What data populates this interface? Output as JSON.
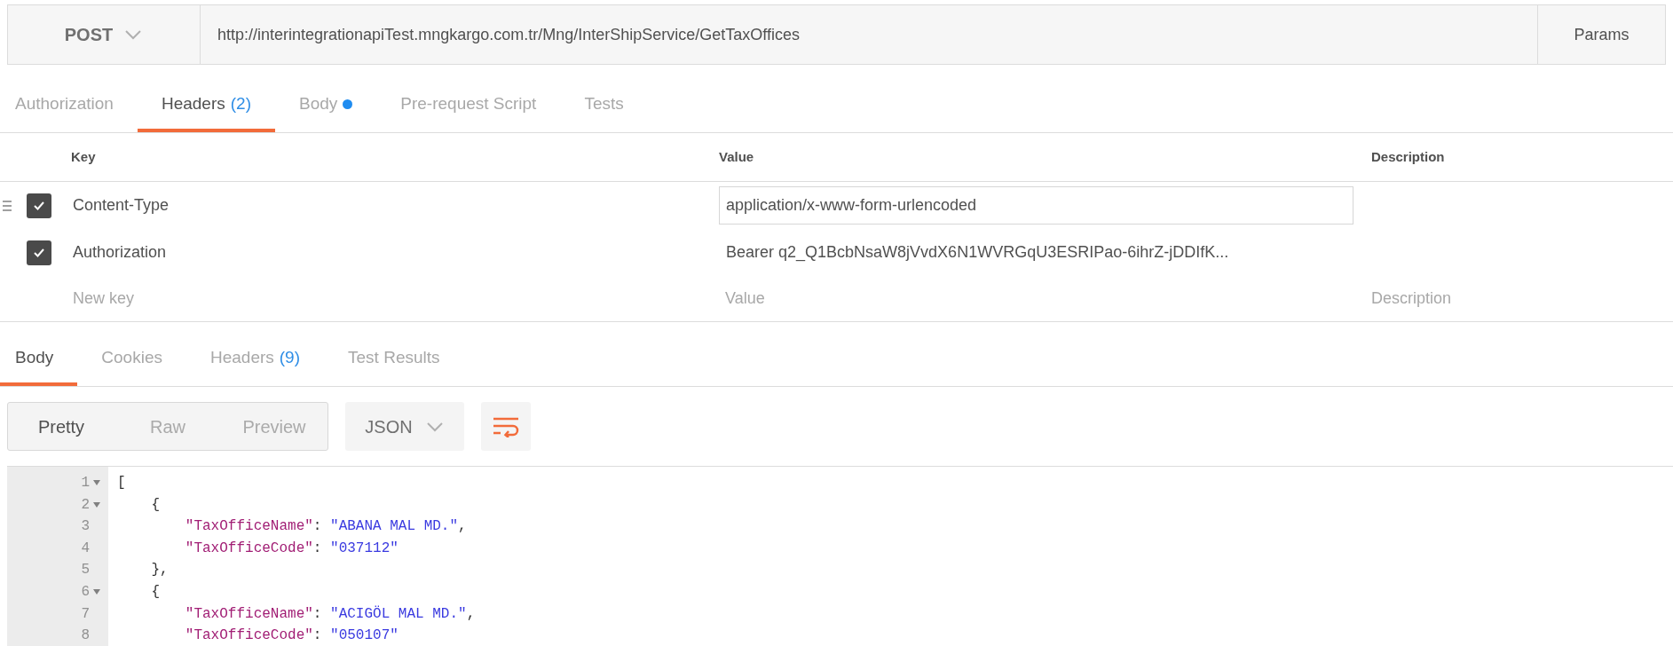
{
  "request_bar": {
    "method": "POST",
    "url": "http://interintegrationapiTest.mngkargo.com.tr/Mng/InterShipService/GetTaxOffices",
    "params_button": "Params"
  },
  "request_tabs": [
    {
      "label": "Authorization",
      "selected": false
    },
    {
      "label": "Headers",
      "count": "(2)",
      "selected": true
    },
    {
      "label": "Body",
      "dot": true,
      "selected": false
    },
    {
      "label": "Pre-request Script",
      "selected": false
    },
    {
      "label": "Tests",
      "selected": false
    }
  ],
  "headers_table": {
    "columns": [
      "Key",
      "Value",
      "Description"
    ],
    "rows": [
      {
        "key": "Content-Type",
        "value": "application/x-www-form-urlencoded",
        "checked": true,
        "editing": true
      },
      {
        "key": "Authorization",
        "value": "Bearer q2_Q1BcbNsaW8jVvdX6N1WVRGqU3ESRIPao-6ihrZ-jDDIfK...",
        "checked": true,
        "editing": false
      }
    ],
    "new_row": {
      "key_placeholder": "New key",
      "value_placeholder": "Value",
      "description_placeholder": "Description"
    }
  },
  "response_tabs": [
    {
      "label": "Body",
      "selected": true
    },
    {
      "label": "Cookies",
      "selected": false
    },
    {
      "label": "Headers",
      "count": "(9)",
      "selected": false
    },
    {
      "label": "Test Results",
      "selected": false
    }
  ],
  "view_modes": [
    {
      "label": "Pretty",
      "selected": true
    },
    {
      "label": "Raw",
      "selected": false
    },
    {
      "label": "Preview",
      "selected": false
    }
  ],
  "format_select": "JSON",
  "code_lines": [
    {
      "number": "1",
      "foldable": true,
      "tokens": [
        {
          "kind": "punct",
          "text": "["
        }
      ]
    },
    {
      "number": "2",
      "foldable": true,
      "tokens": [
        {
          "kind": "punct",
          "text": "    {"
        }
      ]
    },
    {
      "number": "3",
      "foldable": false,
      "tokens": [
        {
          "kind": "key",
          "text": "        \"TaxOfficeName\""
        },
        {
          "kind": "punct",
          "text": ": "
        },
        {
          "kind": "string",
          "text": "\"ABANA MAL MD.\""
        },
        {
          "kind": "punct",
          "text": ","
        }
      ]
    },
    {
      "number": "4",
      "foldable": false,
      "tokens": [
        {
          "kind": "key",
          "text": "        \"TaxOfficeCode\""
        },
        {
          "kind": "punct",
          "text": ": "
        },
        {
          "kind": "string",
          "text": "\"037112\""
        }
      ]
    },
    {
      "number": "5",
      "foldable": false,
      "tokens": [
        {
          "kind": "punct",
          "text": "    },"
        }
      ]
    },
    {
      "number": "6",
      "foldable": true,
      "tokens": [
        {
          "kind": "punct",
          "text": "    {"
        }
      ]
    },
    {
      "number": "7",
      "foldable": false,
      "tokens": [
        {
          "kind": "key",
          "text": "        \"TaxOfficeName\""
        },
        {
          "kind": "punct",
          "text": ": "
        },
        {
          "kind": "string",
          "text": "\"ACIGÖL MAL MD.\""
        },
        {
          "kind": "punct",
          "text": ","
        }
      ]
    },
    {
      "number": "8",
      "foldable": false,
      "tokens": [
        {
          "kind": "key",
          "text": "        \"TaxOfficeCode\""
        },
        {
          "kind": "punct",
          "text": ": "
        },
        {
          "kind": "string",
          "text": "\"050107\""
        }
      ]
    }
  ]
}
